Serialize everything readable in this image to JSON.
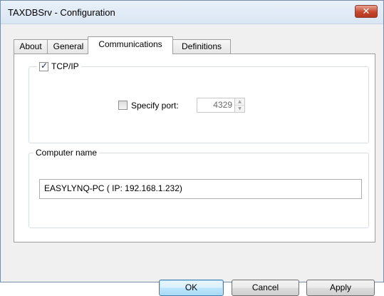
{
  "window": {
    "title": "TAXDBSrv - Configuration",
    "close_glyph": "✕"
  },
  "tabs": [
    {
      "label": "About"
    },
    {
      "label": "General"
    },
    {
      "label": "Communications"
    },
    {
      "label": "Definitions"
    }
  ],
  "active_tab": "Communications",
  "tcpip": {
    "label": "TCP/IP",
    "checked": true,
    "check_glyph": "✓",
    "specify_port": {
      "label": "Specify port:",
      "checked": false,
      "port_value": "4329",
      "enabled": false,
      "up_glyph": "▲",
      "down_glyph": "▼"
    }
  },
  "computer_name": {
    "label": "Computer name",
    "value": "EASYLYNQ-PC  ( IP: 192.168.1.232)"
  },
  "buttons": {
    "ok": "OK",
    "cancel": "Cancel",
    "apply": "Apply"
  },
  "colors": {
    "close_button": "#c6462c",
    "default_button_border": "#3c7fb1",
    "titlebar": "#dae6f3"
  }
}
